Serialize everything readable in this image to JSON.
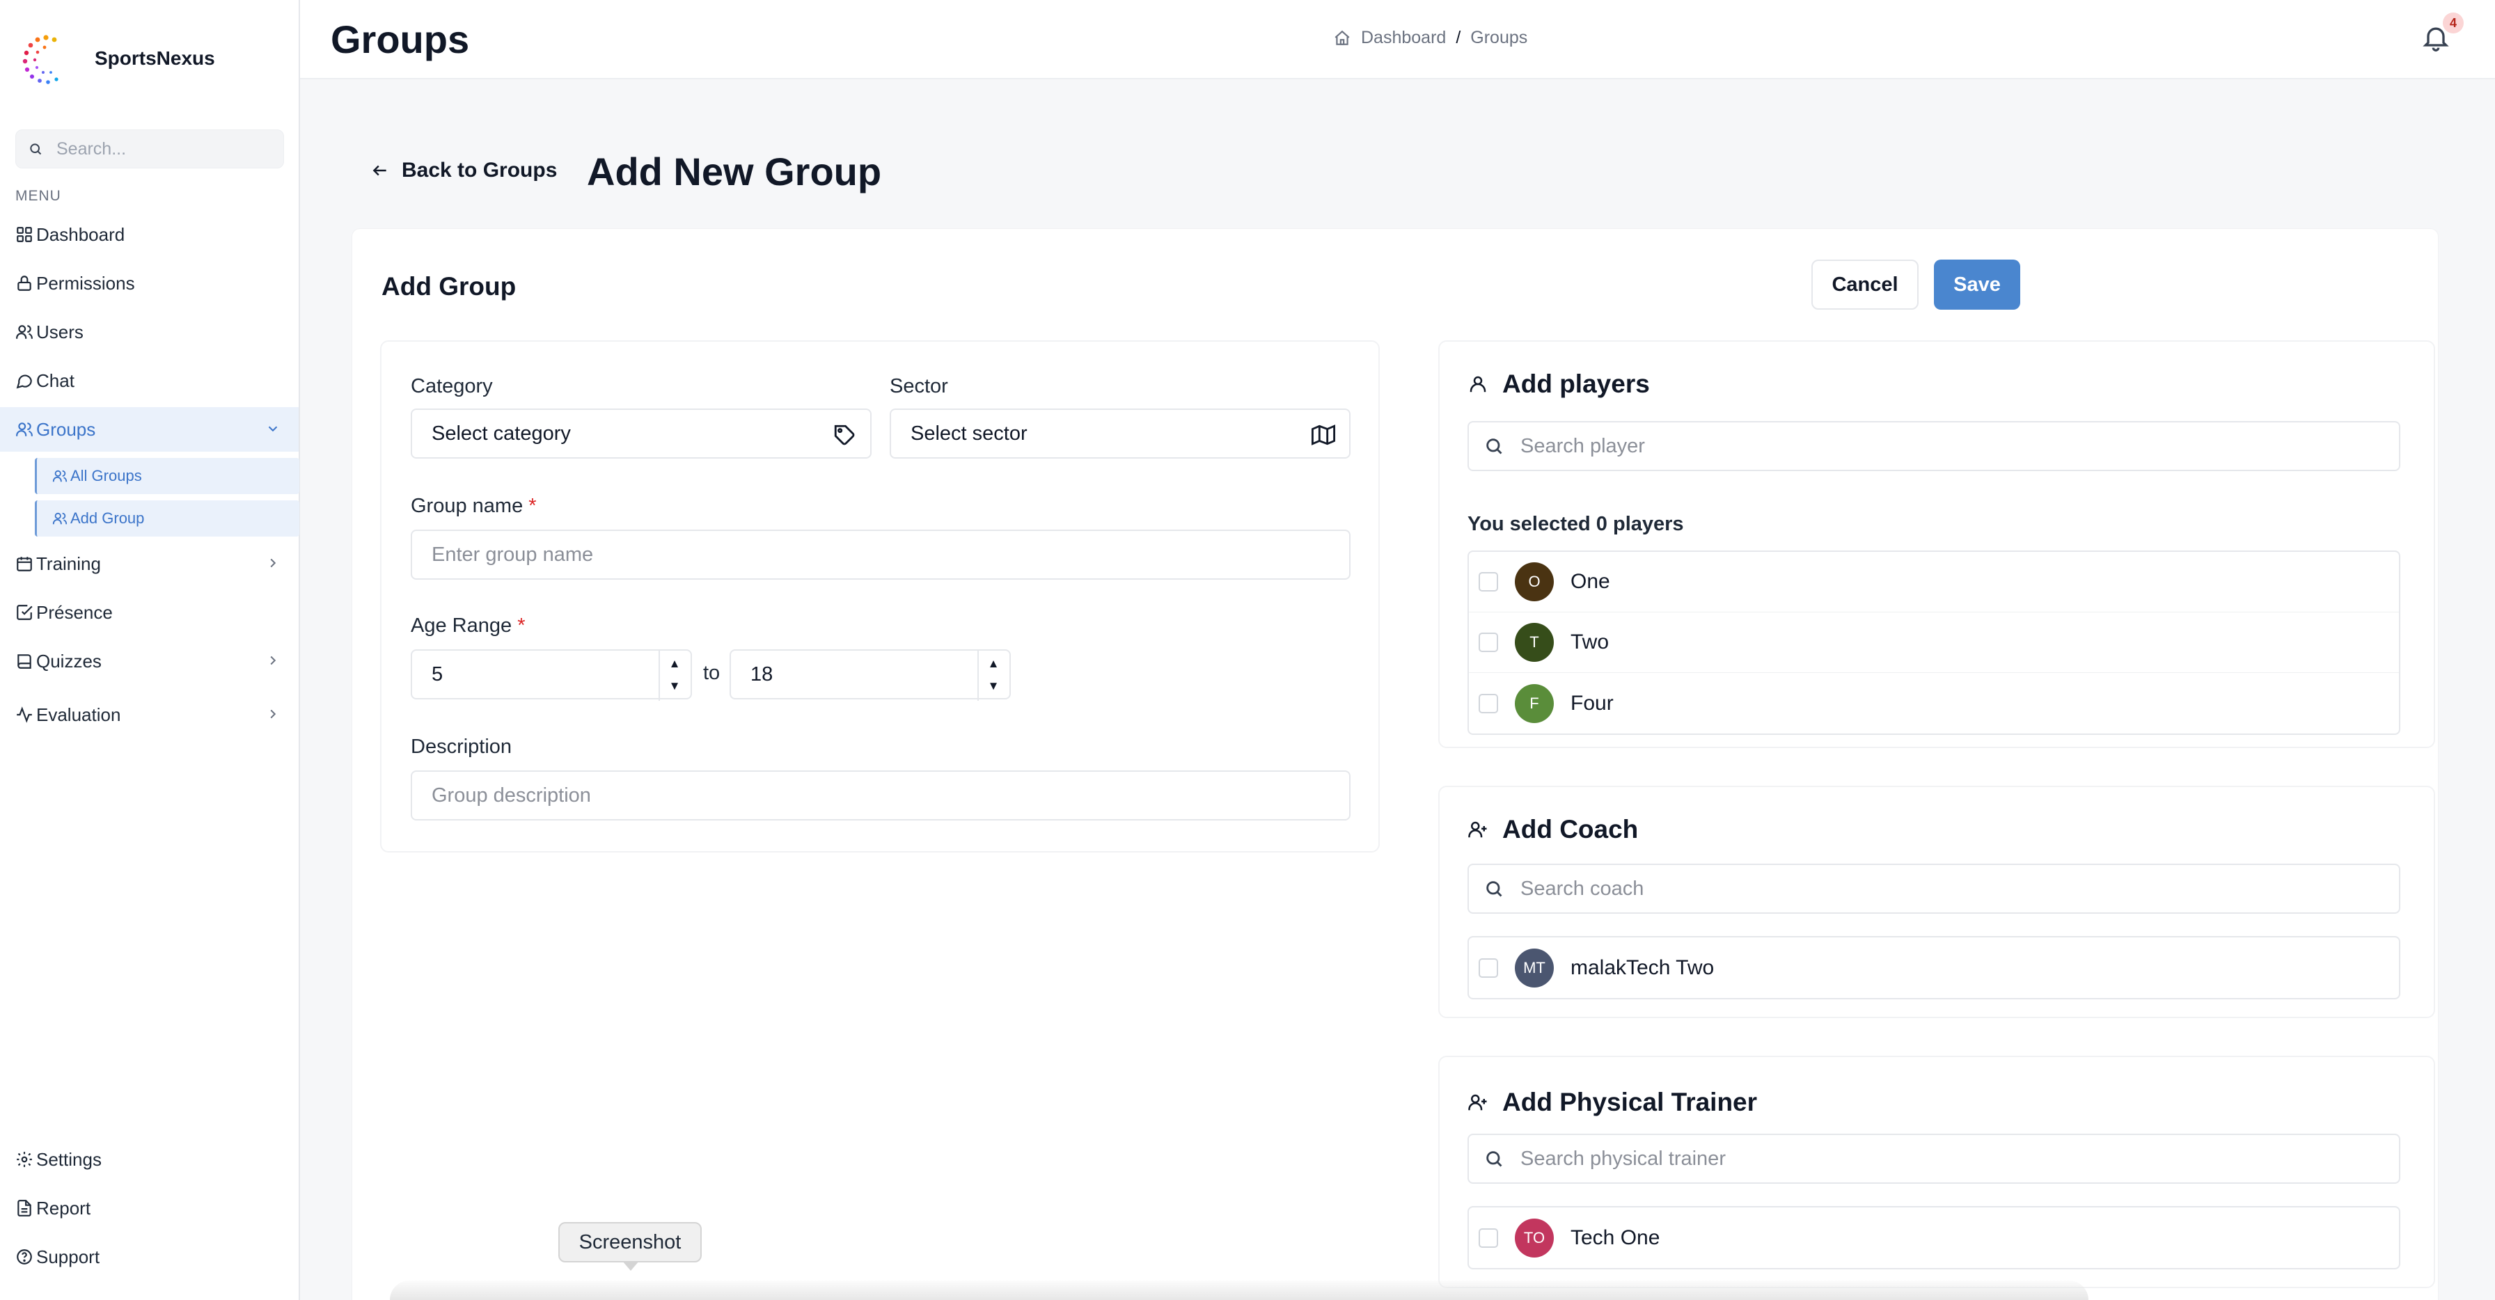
{
  "brand": {
    "name": "SportsNexus"
  },
  "sidebar": {
    "search_placeholder": "Search...",
    "menu_label": "MENU",
    "items": [
      {
        "label": "Dashboard",
        "icon": "grid-icon"
      },
      {
        "label": "Permissions",
        "icon": "lock-icon"
      },
      {
        "label": "Users",
        "icon": "users-icon"
      },
      {
        "label": "Chat",
        "icon": "chat-icon"
      },
      {
        "label": "Groups",
        "icon": "users-icon",
        "active": true,
        "expanded": true
      },
      {
        "label": "Training",
        "icon": "calendar-icon",
        "has_children": true
      },
      {
        "label": "Présence",
        "icon": "check-square-icon"
      },
      {
        "label": "Quizzes",
        "icon": "book-icon",
        "has_children": true
      },
      {
        "label": "Evaluation",
        "icon": "activity-icon",
        "has_children": true
      }
    ],
    "groups_sub": [
      {
        "label": "All Groups"
      },
      {
        "label": "Add Group"
      }
    ],
    "bottom_items": [
      {
        "label": "Settings",
        "icon": "gear-icon"
      },
      {
        "label": "Report",
        "icon": "file-icon"
      },
      {
        "label": "Support",
        "icon": "help-icon"
      }
    ]
  },
  "header": {
    "title": "Groups",
    "breadcrumb": [
      "Dashboard",
      "/",
      "Groups"
    ],
    "notification_count": "4"
  },
  "page": {
    "back_label": "Back to Groups",
    "title": "Add New Group"
  },
  "form": {
    "card_title": "Add Group",
    "cancel_label": "Cancel",
    "save_label": "Save",
    "category": {
      "label": "Category",
      "value": "Select category"
    },
    "sector": {
      "label": "Sector",
      "value": "Select sector"
    },
    "group_name": {
      "label": "Group name",
      "required_mark": "*",
      "placeholder": "Enter group name"
    },
    "age_range": {
      "label": "Age Range",
      "required_mark": "*",
      "min": "5",
      "max": "18",
      "to_label": "to"
    },
    "description": {
      "label": "Description",
      "placeholder": "Group description"
    }
  },
  "players": {
    "title": "Add players",
    "search_placeholder": "Search player",
    "selected_text": "You selected 0 players",
    "items": [
      {
        "initial": "O",
        "name": "One",
        "color": "#4a3312"
      },
      {
        "initial": "T",
        "name": "Two",
        "color": "#364d1a"
      },
      {
        "initial": "F",
        "name": "Four",
        "color": "#5a8d3a"
      }
    ]
  },
  "coach": {
    "title": "Add Coach",
    "search_placeholder": "Search coach",
    "items": [
      {
        "initial": "MT",
        "name": "malakTech Two",
        "color": "#4b5670"
      }
    ]
  },
  "trainer": {
    "title": "Add Physical Trainer",
    "search_placeholder": "Search physical trainer",
    "items": [
      {
        "initial": "TO",
        "name": "Tech One",
        "color": "#c2365e"
      }
    ]
  },
  "overlay": {
    "tooltip": "Screenshot"
  },
  "colors": {
    "accent": "#4a86cf",
    "active_bg": "#eaf1fb",
    "required": "#dc2626"
  }
}
